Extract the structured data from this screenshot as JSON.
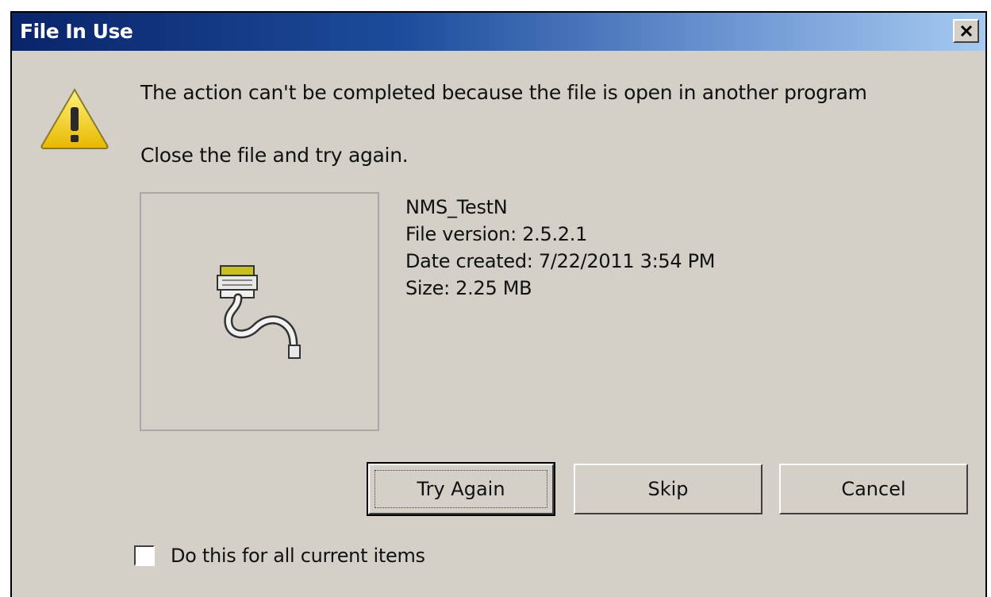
{
  "window": {
    "title": "File In Use"
  },
  "message": {
    "primary": "The action can't be completed because the file is open in another program",
    "secondary": "Close the file and try again."
  },
  "file": {
    "name": "NMS_TestN",
    "version": "File version: 2.5.2.1",
    "date_created": "Date created: 7/22/2011 3:54 PM",
    "size": "Size: 2.25 MB",
    "icon": "plug-cable-icon"
  },
  "buttons": {
    "try_again": "Try Again",
    "skip": "Skip",
    "cancel": "Cancel"
  },
  "checkbox": {
    "label": "Do this for all current items",
    "checked": false
  },
  "colors": {
    "title_gradient_start": "#0a246a",
    "title_gradient_end": "#a6caf0",
    "dialog_bg": "#d4d0c8",
    "warning_yellow": "#f5d000"
  }
}
